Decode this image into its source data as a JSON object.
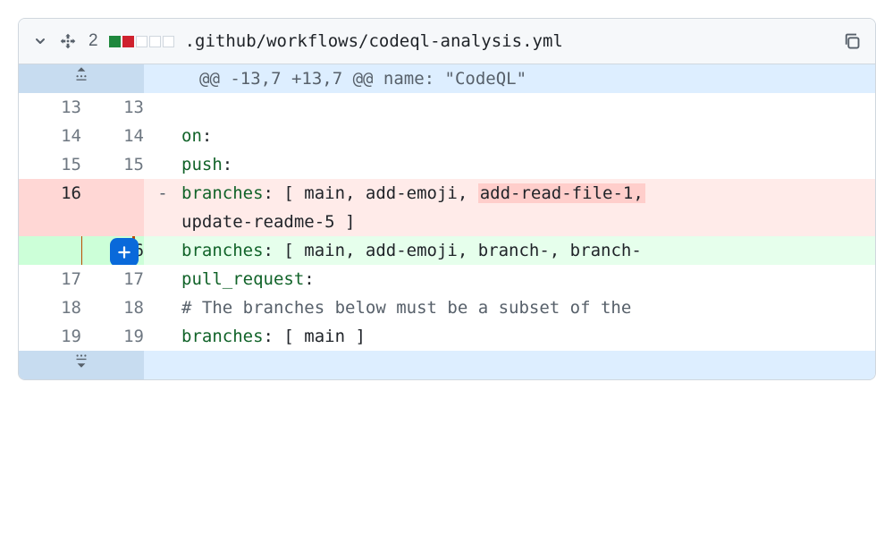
{
  "header": {
    "change_count": "2",
    "file_path": ".github/workflows/codeql-analysis.yml"
  },
  "hunk": {
    "header": "@@ -13,7 +13,7 @@ name: \"CodeQL\""
  },
  "lines": [
    {
      "old": "13",
      "new": "13",
      "marker": "",
      "code": ""
    },
    {
      "old": "14",
      "new": "14",
      "marker": "",
      "code_key": "on",
      "code_colon": ":"
    },
    {
      "old": "15",
      "new": "15",
      "marker": "",
      "indent": "  ",
      "code_key": "push",
      "code_colon": ":"
    },
    {
      "old": "16",
      "new": "",
      "marker": "-",
      "indent": "    ",
      "code_key": "branches",
      "code_rest": ": [ main, add-emoji, ",
      "highlight": "add-read-file-1,",
      "wrap": "update-readme-5 ]"
    },
    {
      "old": "",
      "new": "16",
      "marker": "+",
      "indent": "    ",
      "code_key": "branches",
      "code_rest": ": [ main, add-emoji, branch-, branch-"
    },
    {
      "old": "17",
      "new": "17",
      "marker": "",
      "indent": "  ",
      "code_key": "pull_request",
      "code_colon": ":"
    },
    {
      "old": "18",
      "new": "18",
      "marker": "",
      "indent": "    ",
      "comment": "# The branches below must be a subset of the "
    },
    {
      "old": "19",
      "new": "19",
      "marker": "",
      "indent": "    ",
      "code_key": "branches",
      "code_rest": ": [ main ]"
    }
  ]
}
